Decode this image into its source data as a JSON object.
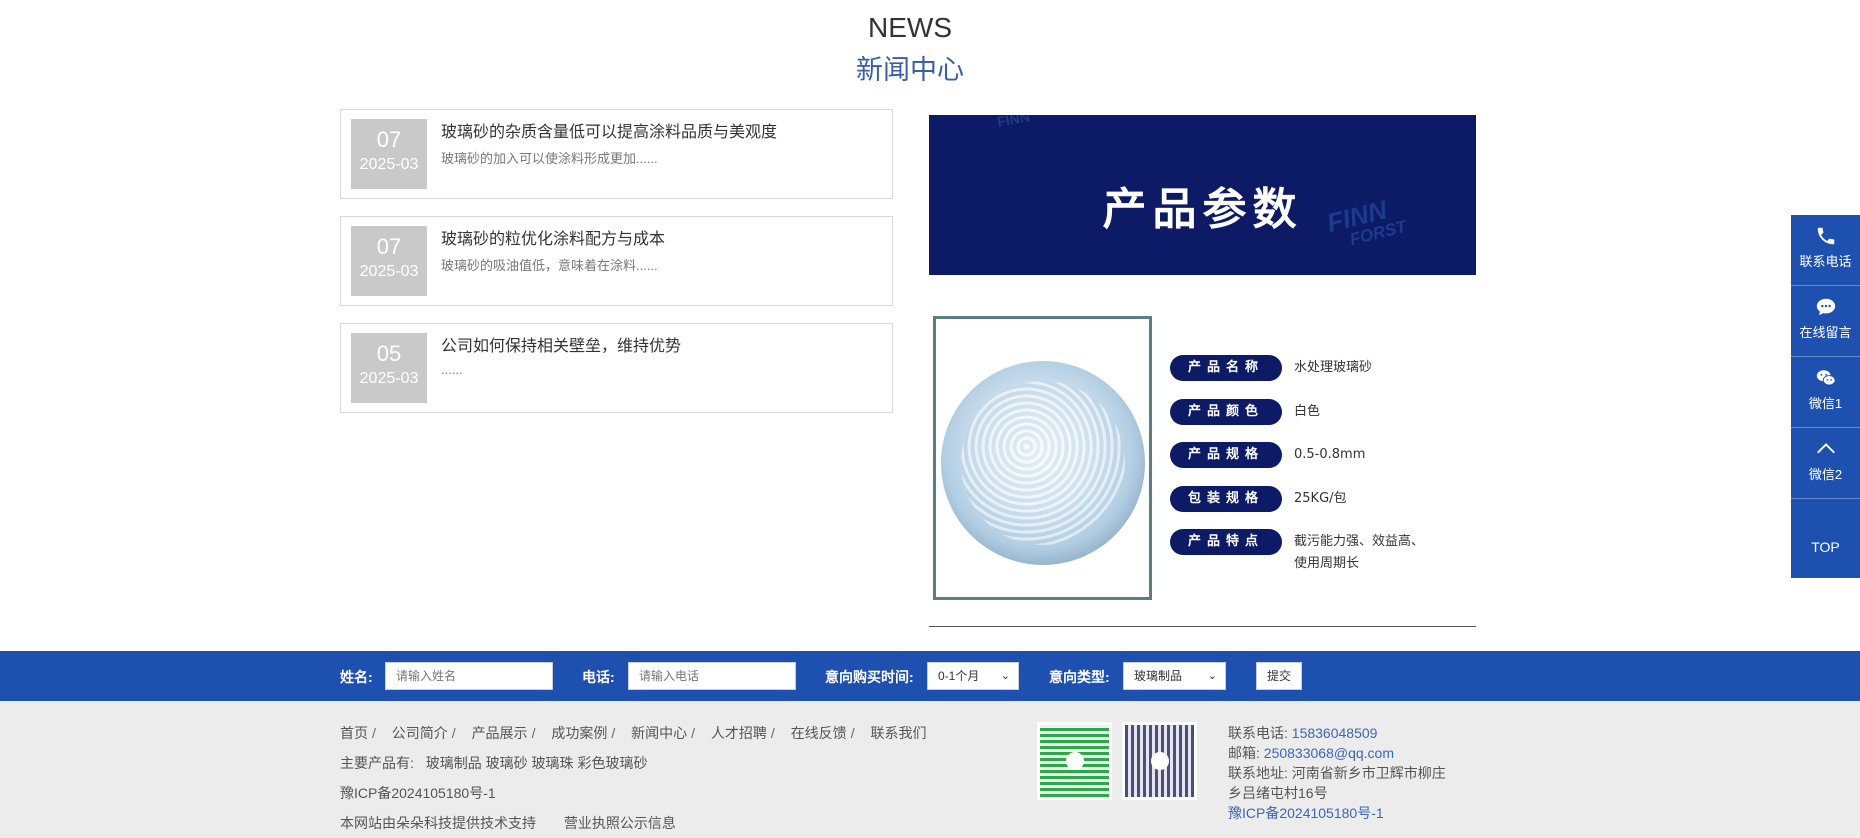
{
  "heading": {
    "en": "NEWS",
    "cn": "新闻中心"
  },
  "news": [
    {
      "day": "07",
      "ym": "2025-03",
      "title": "玻璃砂的杂质含量低可以提高涂料品质与美观度",
      "desc": "玻璃砂的加入可以使涂料形成更加......"
    },
    {
      "day": "07",
      "ym": "2025-03",
      "title": "玻璃砂的粒优化涂料配方与成本",
      "desc": "玻璃砂的吸油值低，意味着在涂料......"
    },
    {
      "day": "05",
      "ym": "2025-03",
      "title": "公司如何保持相关壁垒，维持优势",
      "desc": "......"
    }
  ],
  "banner": {
    "title": "产品参数",
    "watermark_small": "FINN",
    "watermark_big": "FINN",
    "watermark_sub": "FORST"
  },
  "specs": [
    {
      "label": "产品名称",
      "value": "水处理玻璃砂"
    },
    {
      "label": "产品颜色",
      "value": "白色"
    },
    {
      "label": "产品规格",
      "value": "0.5-0.8mm"
    },
    {
      "label": "包装规格",
      "value": "25KG/包"
    },
    {
      "label": "产品特点",
      "value": "截污能力强、效益高、",
      "value2": "使用周期长"
    }
  ],
  "form": {
    "name_label": "姓名:",
    "name_placeholder": "请输入姓名",
    "phone_label": "电话:",
    "phone_placeholder": "请输入电话",
    "time_label": "意向购买时间:",
    "time_value": "0-1个月",
    "type_label": "意向类型:",
    "type_value": "玻璃制品",
    "submit": "提交"
  },
  "footer": {
    "nav": [
      "首页",
      "公司简介",
      "产品展示",
      "成功案例",
      "新闻中心",
      "人才招聘",
      "在线反馈",
      "联系我们"
    ],
    "nav_sep": "/",
    "products_label": "主要产品有:",
    "products": "玻璃制品 玻璃砂 玻璃珠 彩色玻璃砂",
    "icp": "豫ICP备2024105180号-1",
    "support": "本网站由朵朵科技提供技术支持",
    "license": "营业执照公示信息",
    "phone_label": "联系电话:",
    "phone": "15836048509",
    "email_label": "邮箱:",
    "email": "250833068@qq.com",
    "address_label": "联系地址:",
    "address1": "河南省新乡市卫辉市柳庄",
    "address2": "乡吕绪屯村16号",
    "icp2": "豫ICP备2024105180号-1"
  },
  "sidebar": [
    {
      "label": "联系电话",
      "icon": "phone-icon"
    },
    {
      "label": "在线留言",
      "icon": "message-icon"
    },
    {
      "label": "微信1",
      "icon": "wechat-icon"
    },
    {
      "label": "微信2",
      "icon": "chevron-up-icon"
    },
    {
      "label": "TOP",
      "icon": ""
    }
  ]
}
